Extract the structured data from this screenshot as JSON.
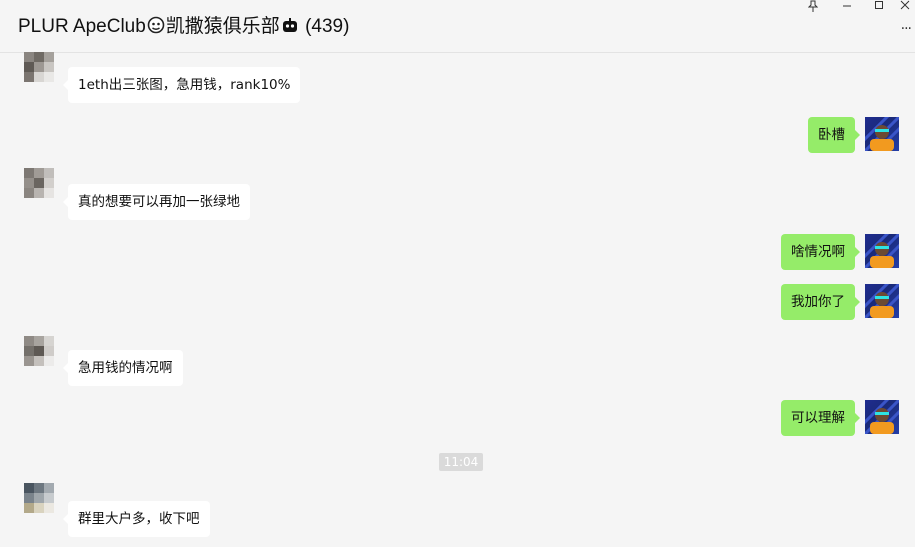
{
  "header": {
    "title_part1": "PLUR ApeClub",
    "title_part2": "凯撒猿俱乐部",
    "member_count": "(439)"
  },
  "window_controls": {
    "pin": "⊥",
    "minimize": "—",
    "maximize": "☐",
    "close": "✕",
    "more": "···"
  },
  "messages": [
    {
      "side": "left",
      "text": "1eth出三张图，急用钱，rank10%"
    },
    {
      "side": "right",
      "text": "卧槽"
    },
    {
      "side": "left",
      "text": "真的想要可以再加一张绿地"
    },
    {
      "side": "right",
      "text": "啥情况啊"
    },
    {
      "side": "right",
      "text": "我加你了"
    },
    {
      "side": "left",
      "text": "急用钱的情况啊"
    },
    {
      "side": "right",
      "text": "可以理解"
    },
    {
      "side": "left",
      "text": "群里大户多，收下吧"
    }
  ],
  "timestamp": "11:04",
  "colors": {
    "background": "#f5f5f5",
    "incoming_bubble": "#ffffff",
    "outgoing_bubble": "#95ec69",
    "timestamp_bg": "#dadada"
  }
}
